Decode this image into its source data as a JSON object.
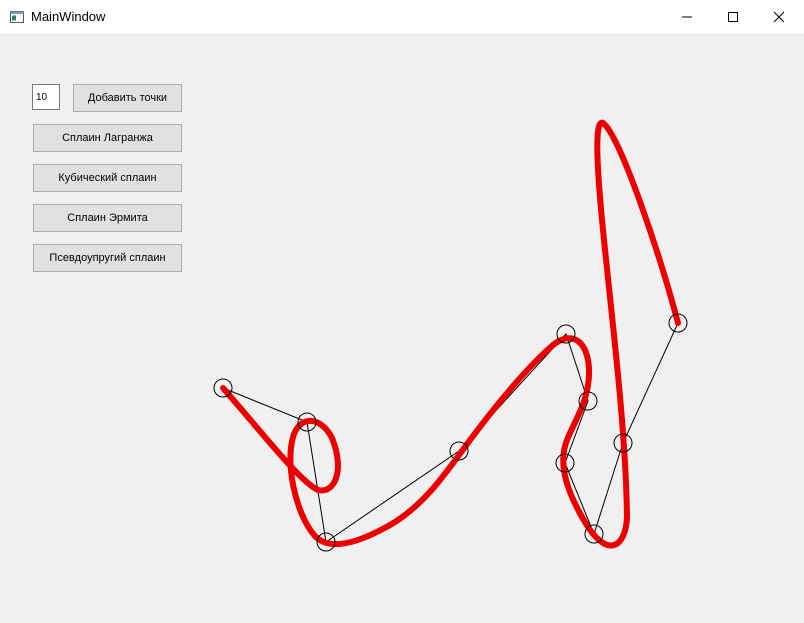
{
  "window": {
    "title": "MainWindow"
  },
  "controls": {
    "points_count": "10",
    "add_points_label": "Добавить точки",
    "lagrange_label": "Сплаин Лагранжа",
    "cubic_label": "Кубический сплаин",
    "hermite_label": "Сплаин Эрмита",
    "pseudo_elastic_label": "Псевдоупругий сплаин"
  },
  "colors": {
    "spline": "#ee0000",
    "polyline": "#000000",
    "point": "#000000"
  }
}
